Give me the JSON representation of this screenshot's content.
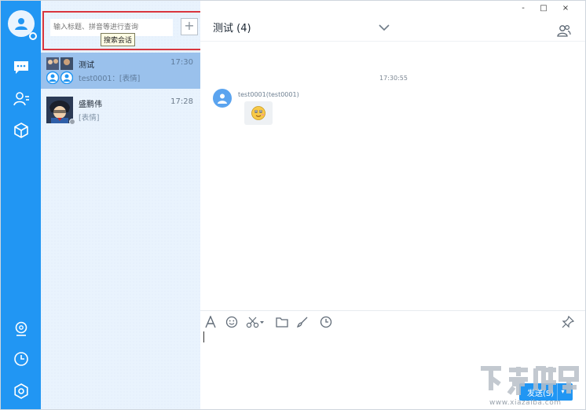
{
  "window": {
    "minimize": "-",
    "maximize": "□",
    "close": "×"
  },
  "search": {
    "placeholder": "输入标题、拼音等进行查询",
    "add_label": "+",
    "tooltip": "搜索会话"
  },
  "conversations": [
    {
      "name": "测试",
      "time": "17:30",
      "last_message": "test0001：[表情]",
      "active": true
    },
    {
      "name": "盛鹏伟",
      "time": "17:28",
      "last_message": "[表情]",
      "active": false
    }
  ],
  "chat": {
    "title": "测试 (4)",
    "timestamp": "17:30:55",
    "message": {
      "sender": "test0001(test0001)"
    }
  },
  "composer": {
    "send_label": "发送(S)",
    "send_dropdown": "▾"
  },
  "watermark": {
    "text": "www.xiazaiba.com"
  },
  "colors": {
    "brand": "#2196f3",
    "list_bg": "#e9f3fd",
    "active_conv": "#9ac1ec",
    "highlight_border": "#d9363e"
  }
}
